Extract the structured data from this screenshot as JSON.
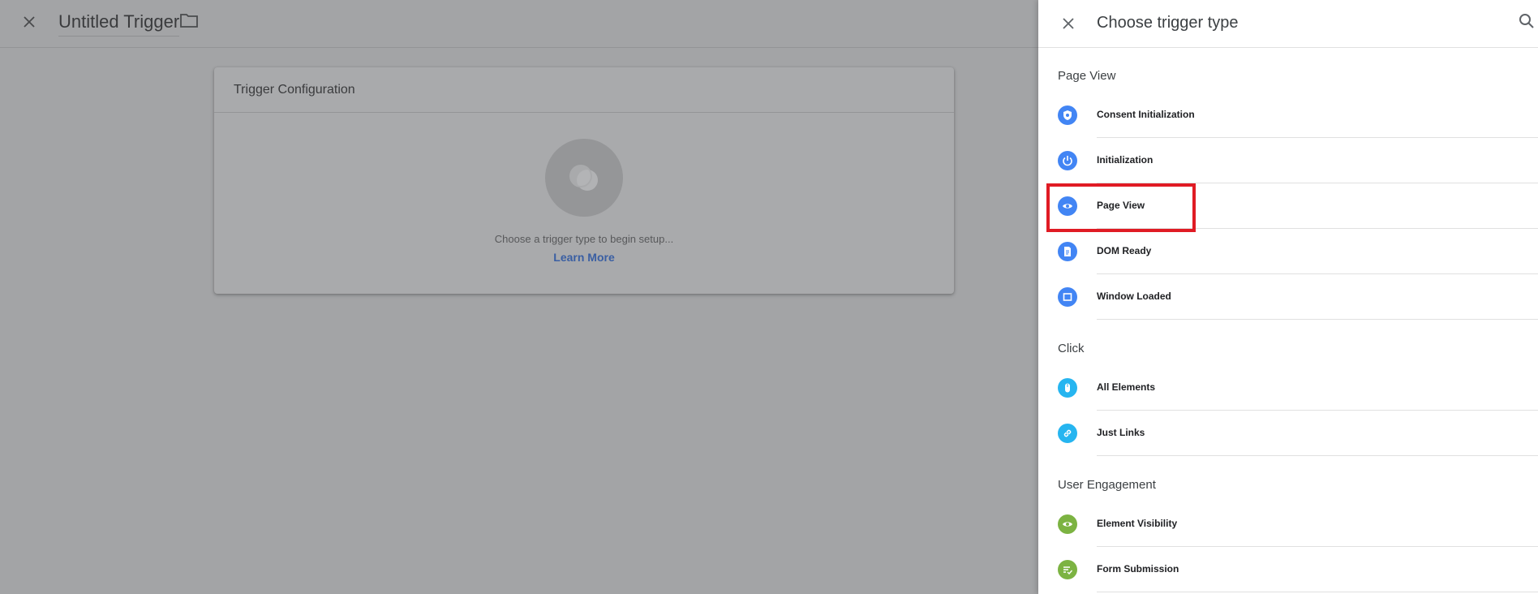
{
  "editor": {
    "title": "Untitled Trigger",
    "card_title": "Trigger Configuration",
    "hint": "Choose a trigger type to begin setup...",
    "learn_more": "Learn More"
  },
  "drawer": {
    "title": "Choose trigger type",
    "sections": [
      {
        "title": "Page View",
        "items": [
          {
            "label": "Consent Initialization",
            "icon": "shield-icon",
            "color": "#4285f4"
          },
          {
            "label": "Initialization",
            "icon": "power-icon",
            "color": "#4285f4"
          },
          {
            "label": "Page View",
            "icon": "eye-icon",
            "color": "#4285f4"
          },
          {
            "label": "DOM Ready",
            "icon": "document-icon",
            "color": "#4285f4"
          },
          {
            "label": "Window Loaded",
            "icon": "window-icon",
            "color": "#4285f4"
          }
        ]
      },
      {
        "title": "Click",
        "items": [
          {
            "label": "All Elements",
            "icon": "mouse-icon",
            "color": "#26b5f0"
          },
          {
            "label": "Just Links",
            "icon": "link-icon",
            "color": "#26b5f0"
          }
        ]
      },
      {
        "title": "User Engagement",
        "items": [
          {
            "label": "Element Visibility",
            "icon": "eye-icon",
            "color": "#7cb342"
          },
          {
            "label": "Form Submission",
            "icon": "form-icon",
            "color": "#7cb342"
          }
        ]
      }
    ]
  },
  "colors": {
    "accent_blue": "#4285f4",
    "click_blue": "#26b5f0",
    "engagement_green": "#7cb342",
    "highlight_red": "#e01b24"
  }
}
